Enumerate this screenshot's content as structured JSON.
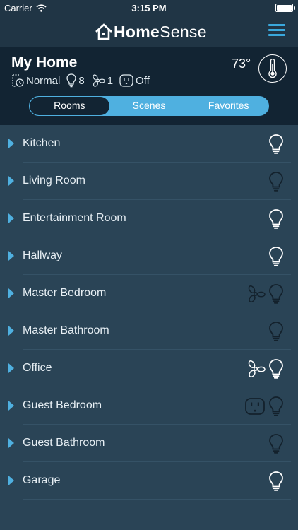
{
  "status_bar": {
    "carrier": "Carrier",
    "time": "3:15 PM"
  },
  "app": {
    "brand_part1": "Home",
    "brand_part2": "Sense"
  },
  "home": {
    "title": "My Home",
    "temperature": "73°",
    "stats": {
      "mode": "Normal",
      "lights_count": "8",
      "fans_count": "1",
      "outlet_state": "Off"
    }
  },
  "tabs": [
    {
      "label": "Rooms",
      "active": true
    },
    {
      "label": "Scenes",
      "active": false
    },
    {
      "label": "Favorites",
      "active": false
    }
  ],
  "rooms": [
    {
      "name": "Kitchen",
      "devices": [
        {
          "icon": "lightbulb-icon",
          "on": true
        }
      ]
    },
    {
      "name": "Living Room",
      "devices": [
        {
          "icon": "lightbulb-icon",
          "on": false
        }
      ]
    },
    {
      "name": "Entertainment Room",
      "devices": [
        {
          "icon": "lightbulb-icon",
          "on": true
        }
      ]
    },
    {
      "name": "Hallway",
      "devices": [
        {
          "icon": "lightbulb-icon",
          "on": true
        }
      ]
    },
    {
      "name": "Master Bedroom",
      "devices": [
        {
          "icon": "fan-icon",
          "on": false
        },
        {
          "icon": "lightbulb-icon",
          "on": false
        }
      ]
    },
    {
      "name": "Master Bathroom",
      "devices": [
        {
          "icon": "lightbulb-icon",
          "on": false
        }
      ]
    },
    {
      "name": "Office",
      "devices": [
        {
          "icon": "fan-icon",
          "on": true
        },
        {
          "icon": "lightbulb-icon",
          "on": true
        }
      ]
    },
    {
      "name": "Guest Bedroom",
      "devices": [
        {
          "icon": "outlet-icon",
          "on": false
        },
        {
          "icon": "lightbulb-icon",
          "on": false
        }
      ]
    },
    {
      "name": "Guest Bathroom",
      "devices": [
        {
          "icon": "lightbulb-icon",
          "on": false
        }
      ]
    },
    {
      "name": "Garage",
      "devices": [
        {
          "icon": "lightbulb-icon",
          "on": true
        }
      ]
    }
  ],
  "colors": {
    "accent": "#4fb0e0",
    "icon_on": "#ffffff",
    "icon_off": "#13212c"
  }
}
